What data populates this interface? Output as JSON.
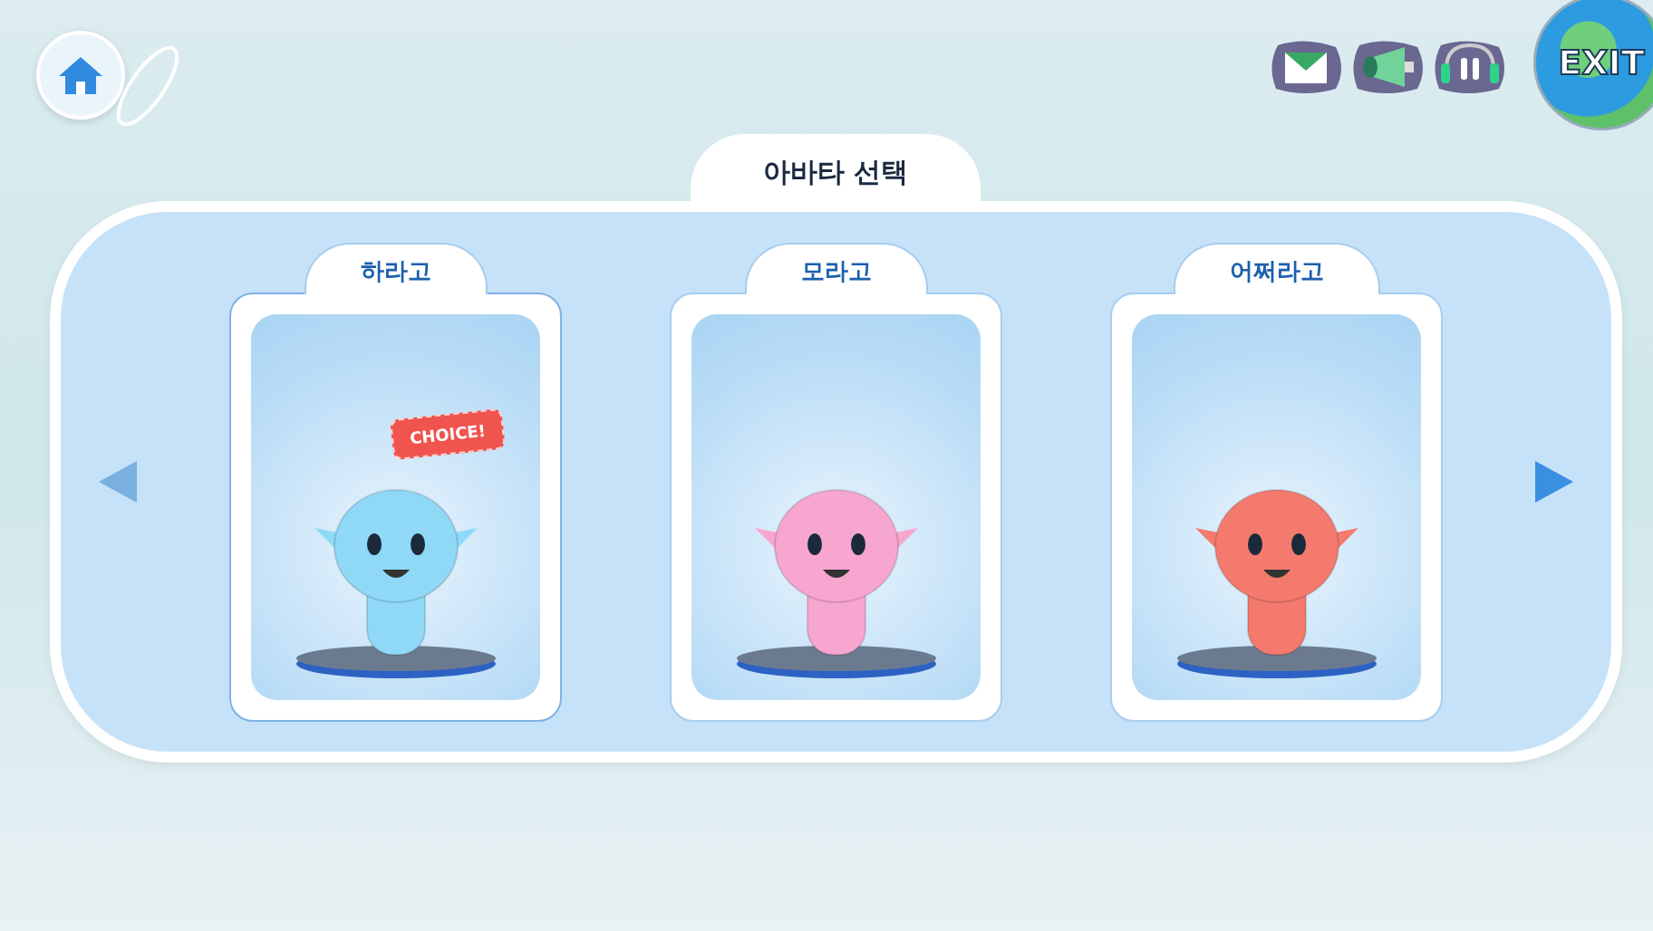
{
  "top_bar": {
    "exit_label": "EXIT"
  },
  "title": "아바타 선택",
  "choice_badge": "CHOICE!",
  "avatars": [
    {
      "name": "하라고",
      "selected": true,
      "color": "#8fd9f7"
    },
    {
      "name": "모라고",
      "selected": false,
      "color": "#f7a6d0"
    },
    {
      "name": "어쩌라고",
      "selected": false,
      "color": "#f47a6e"
    }
  ]
}
